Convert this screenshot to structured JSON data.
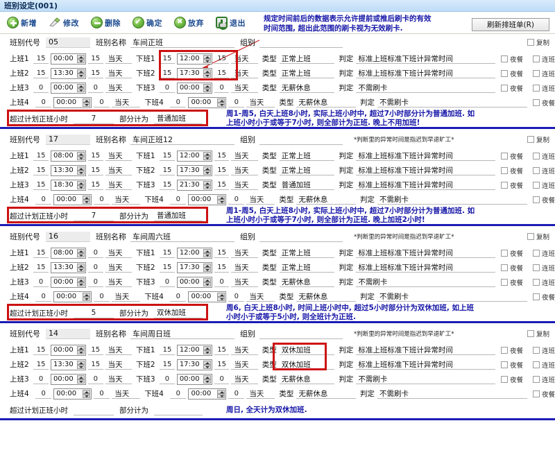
{
  "window": {
    "title": "班别设定(001)"
  },
  "toolbar": {
    "items": [
      {
        "label": "新增",
        "icon": "add-circle-icon"
      },
      {
        "label": "修改",
        "icon": "pencil-icon"
      },
      {
        "label": "删除",
        "icon": "minus-circle-icon"
      },
      {
        "label": "确定",
        "icon": "check-circle-icon"
      },
      {
        "label": "放弃",
        "icon": "cancel-circle-icon"
      },
      {
        "label": "退出",
        "icon": "power-icon"
      }
    ]
  },
  "annotations": {
    "top_note": "规定时间前后的数据表示允许提前或推后刷卡的有效\n时间范围, 超出此范围的刷卡视为无效刷卡.",
    "refresh_button": "刷新排班单(R)"
  },
  "labels": {
    "shift_code": "班别代号",
    "shift_name": "班别名称",
    "group": "组别",
    "copy": "复制",
    "abnormal_hint": "*判断里的异常时间是指迟到早退旷工*",
    "type": "类型",
    "judge": "判定",
    "night_meal": "夜餐",
    "continuous": "连班",
    "overtime_prefix": "超过计划正班小时",
    "overtime_middle": "部分计为"
  },
  "sections": [
    {
      "code": "05",
      "name": "车间正班",
      "group": "",
      "rows": [
        {
          "in_label": "上班1",
          "in_before": "15",
          "in_time": "00:00",
          "in_after": "15",
          "in_day": "当天",
          "out_label": "下班1",
          "out_before": "15",
          "out_time": "12:00",
          "out_after": "15",
          "out_day": "当天",
          "type": "正常上班",
          "judge": "标准上班标准下班计异常时间",
          "night_meal": false,
          "continuous": false,
          "show_continuous": true
        },
        {
          "in_label": "上班2",
          "in_before": "15",
          "in_time": "13:30",
          "in_after": "15",
          "in_day": "当天",
          "out_label": "下班2",
          "out_before": "15",
          "out_time": "17:30",
          "out_after": "15",
          "out_day": "当天",
          "type": "正常上班",
          "judge": "标准上班标准下班计异常时间",
          "night_meal": false,
          "continuous": false,
          "show_continuous": true
        },
        {
          "in_label": "上班3",
          "in_before": "0",
          "in_time": "00:00",
          "in_after": "0",
          "in_day": "当天",
          "out_label": "下班3",
          "out_before": "0",
          "out_time": "00:00",
          "out_after": "0",
          "out_day": "当天",
          "type": "无薪休息",
          "judge": "不需刷卡",
          "night_meal": false,
          "continuous": false,
          "show_continuous": true
        },
        {
          "in_label": "上班4",
          "in_before": "0",
          "in_time": "00:00",
          "in_after": "0",
          "in_day": "当天",
          "out_label": "下班4",
          "out_before": "0",
          "out_time": "00:00",
          "out_after": "0",
          "out_day": "当天",
          "type": "无薪休息",
          "judge": "不需刷卡",
          "night_meal": false,
          "continuous": false,
          "show_continuous": false
        }
      ],
      "overtime_hours": "7",
      "overtime_type": "普通加班",
      "note": "周1-周5, 白天上班8小时, 实际上班小时中, 超过7小时部分计为普通加班. 如\n上班小时小于或等于7小时, 则全部计为正班.            晚上不用加班!",
      "highlight_overtime": true,
      "highlight_time": true,
      "highlight_type": false
    },
    {
      "code": "17",
      "name": "车间正班12",
      "group": "",
      "rows": [
        {
          "in_label": "上班1",
          "in_before": "15",
          "in_time": "08:00",
          "in_after": "15",
          "in_day": "当天",
          "out_label": "下班1",
          "out_before": "15",
          "out_time": "12:00",
          "out_after": "15",
          "out_day": "当天",
          "type": "正常上班",
          "judge": "标准上班标准下班计异常时间",
          "night_meal": false,
          "continuous": false,
          "show_continuous": true
        },
        {
          "in_label": "上班2",
          "in_before": "15",
          "in_time": "13:30",
          "in_after": "15",
          "in_day": "当天",
          "out_label": "下班2",
          "out_before": "15",
          "out_time": "17:30",
          "out_after": "15",
          "out_day": "当天",
          "type": "正常上班",
          "judge": "标准上班标准下班计异常时间",
          "night_meal": false,
          "continuous": false,
          "show_continuous": true
        },
        {
          "in_label": "上班3",
          "in_before": "15",
          "in_time": "18:30",
          "in_after": "15",
          "in_day": "当天",
          "out_label": "下班3",
          "out_before": "15",
          "out_time": "21:30",
          "out_after": "15",
          "out_day": "当天",
          "type": "普通加班",
          "judge": "标准上班标准下班计异常时间",
          "night_meal": false,
          "continuous": false,
          "show_continuous": true
        },
        {
          "in_label": "上班4",
          "in_before": "0",
          "in_time": "00:00",
          "in_after": "0",
          "in_day": "当天",
          "out_label": "下班4",
          "out_before": "0",
          "out_time": "00:00",
          "out_after": "0",
          "out_day": "当天",
          "type": "无薪休息",
          "judge": "不需刷卡",
          "night_meal": false,
          "continuous": false,
          "show_continuous": false
        }
      ],
      "overtime_hours": "7",
      "overtime_type": "普通加班",
      "note": "周1-周5, 白天上班8小时, 实际上班小时中, 超过7小时部分计为普通加班. 如\n上班小时小于或等于7小时, 则全部计为正班.            晚上加班2小时!",
      "highlight_overtime": true,
      "highlight_time": false,
      "highlight_type": false
    },
    {
      "code": "16",
      "name": "车间周六班",
      "group": "",
      "rows": [
        {
          "in_label": "上班1",
          "in_before": "15",
          "in_time": "08:00",
          "in_after": "0",
          "in_day": "当天",
          "out_label": "下班1",
          "out_before": "15",
          "out_time": "12:00",
          "out_after": "15",
          "out_day": "当天",
          "type": "正常上班",
          "judge": "标准上班标准下班计异常时间",
          "night_meal": false,
          "continuous": false,
          "show_continuous": true
        },
        {
          "in_label": "上班2",
          "in_before": "15",
          "in_time": "13:30",
          "in_after": "0",
          "in_day": "当天",
          "out_label": "下班2",
          "out_before": "15",
          "out_time": "17:30",
          "out_after": "15",
          "out_day": "当天",
          "type": "正常上班",
          "judge": "标准上班标准下班计异常时间",
          "night_meal": false,
          "continuous": false,
          "show_continuous": true
        },
        {
          "in_label": "上班3",
          "in_before": "0",
          "in_time": "00:00",
          "in_after": "0",
          "in_day": "当天",
          "out_label": "下班3",
          "out_before": "0",
          "out_time": "00:00",
          "out_after": "0",
          "out_day": "当天",
          "type": "无薪休息",
          "judge": "不需刷卡",
          "night_meal": false,
          "continuous": false,
          "show_continuous": true
        },
        {
          "in_label": "上班4",
          "in_before": "0",
          "in_time": "00:00",
          "in_after": "0",
          "in_day": "当天",
          "out_label": "下班4",
          "out_before": "0",
          "out_time": "00:00",
          "out_after": "0",
          "out_day": "当天",
          "type": "无薪休息",
          "judge": "不需刷卡",
          "night_meal": false,
          "continuous": false,
          "show_continuous": false
        }
      ],
      "overtime_hours": "5",
      "overtime_type": "双休加班",
      "note": "周6, 白天上班8小时, 时间上班小时中, 超过5小时部分计为双休加班, 如上班\n小时小于或等于5小时, 则全班计为正班.",
      "highlight_overtime": true,
      "highlight_time": false,
      "highlight_type": false
    },
    {
      "code": "14",
      "name": "车间周日班",
      "group": "",
      "rows": [
        {
          "in_label": "上班1",
          "in_before": "15",
          "in_time": "00:00",
          "in_after": "15",
          "in_day": "当天",
          "out_label": "下班1",
          "out_before": "15",
          "out_time": "12:00",
          "out_after": "15",
          "out_day": "当天",
          "type": "双休加班",
          "judge": "标准上班标准下班计异常时间",
          "night_meal": false,
          "continuous": false,
          "show_continuous": true
        },
        {
          "in_label": "上班2",
          "in_before": "15",
          "in_time": "13:30",
          "in_after": "15",
          "in_day": "当天",
          "out_label": "下班2",
          "out_before": "15",
          "out_time": "17:30",
          "out_after": "15",
          "out_day": "当天",
          "type": "双休加班",
          "judge": "标准上班标准下班计异常时间",
          "night_meal": false,
          "continuous": false,
          "show_continuous": true
        },
        {
          "in_label": "上班3",
          "in_before": "0",
          "in_time": "00:00",
          "in_after": "0",
          "in_day": "当天",
          "out_label": "下班3",
          "out_before": "0",
          "out_time": "00:00",
          "out_after": "0",
          "out_day": "当天",
          "type": "无薪休息",
          "judge": "不需刷卡",
          "night_meal": false,
          "continuous": false,
          "show_continuous": true
        },
        {
          "in_label": "上班4",
          "in_before": "0",
          "in_time": "00:00",
          "in_after": "0",
          "in_day": "当天",
          "out_label": "下班4",
          "out_before": "0",
          "out_time": "00:00",
          "out_after": "0",
          "out_day": "当天",
          "type": "无薪休息",
          "judge": "不需刷卡",
          "night_meal": false,
          "continuous": false,
          "show_continuous": false
        }
      ],
      "overtime_hours": "",
      "overtime_type": "",
      "note": "周日, 全天计为双休加班.",
      "highlight_overtime": false,
      "highlight_time": false,
      "highlight_type": true
    }
  ]
}
